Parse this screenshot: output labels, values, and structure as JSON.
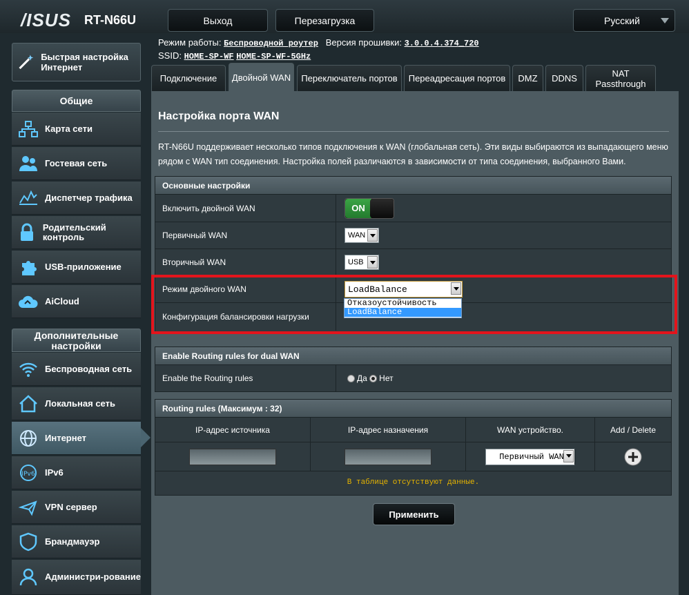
{
  "header": {
    "brand": "/ISUS",
    "model": "RT-N66U",
    "logout": "Выход",
    "reboot": "Перезагрузка",
    "language": "Русский"
  },
  "status": {
    "mode_label": "Режим работы:",
    "mode_value": "Беспроводной роутер",
    "fw_label": "Версия прошивки:",
    "fw_value": "3.0.0.4.374_720",
    "ssid_label": "SSID:",
    "ssid1": "HOME-SP-WF",
    "ssid2": "HOME-SP-WF-5GHz"
  },
  "sidebar": {
    "quick_setup": "Быстрая настройка Интернет",
    "general_title": "Общие",
    "general_items": [
      "Карта сети",
      "Гостевая сеть",
      "Диспетчер трафика",
      "Родительский контроль",
      "USB-приложение",
      "AiCloud"
    ],
    "advanced_title": "Дополнительные настройки",
    "advanced_items": [
      "Беспроводная сеть",
      "Локальная сеть",
      "Интернет",
      "IPv6",
      "VPN сервер",
      "Брандмауэр",
      "Администри-рование"
    ]
  },
  "tabs": [
    "Подключение",
    "Двойной WAN",
    "Переключатель портов",
    "Переадресация портов",
    "DMZ",
    "DDNS",
    "NAT Passthrough"
  ],
  "page": {
    "title": "Настройка порта WAN",
    "description": "RT-N66U поддерживает несколько типов подключения к WAN (глобальная сеть). Эти виды выбираются из выпадающего меню рядом с WAN тип соединения. Настройка полей различаются в зависимости от типа соединения, выбранного Вами."
  },
  "basic": {
    "header": "Основные настройки",
    "enable_label": "Включить двойной WAN",
    "toggle_state": "ON",
    "primary_label": "Первичный WAN",
    "primary_value": "WAN",
    "secondary_label": "Вторичный WAN",
    "secondary_value": "USB",
    "mode_label": "Режим двойного WAN",
    "mode_value": "LoadBalance",
    "mode_options": [
      "Отказоустойчивость",
      "LoadBalance"
    ],
    "lb_label": "Конфигурация балансировки нагрузки"
  },
  "routing": {
    "header": "Enable Routing rules for dual WAN",
    "label": "Enable the Routing rules",
    "yes": "Да",
    "no": "Нет"
  },
  "rules": {
    "header": "Routing rules (Максимум : 32)",
    "columns": [
      "IP-адрес источника",
      "IP-адрес назначения",
      "WAN устройство.",
      "Add / Delete"
    ],
    "wan_select": "Первичный WAN",
    "empty": "В таблице отсутствуют данные."
  },
  "apply": "Применить",
  "colors": {
    "accent": "#e3141c",
    "on_green": "#2e9a3a",
    "empty_text": "#e6b400"
  }
}
